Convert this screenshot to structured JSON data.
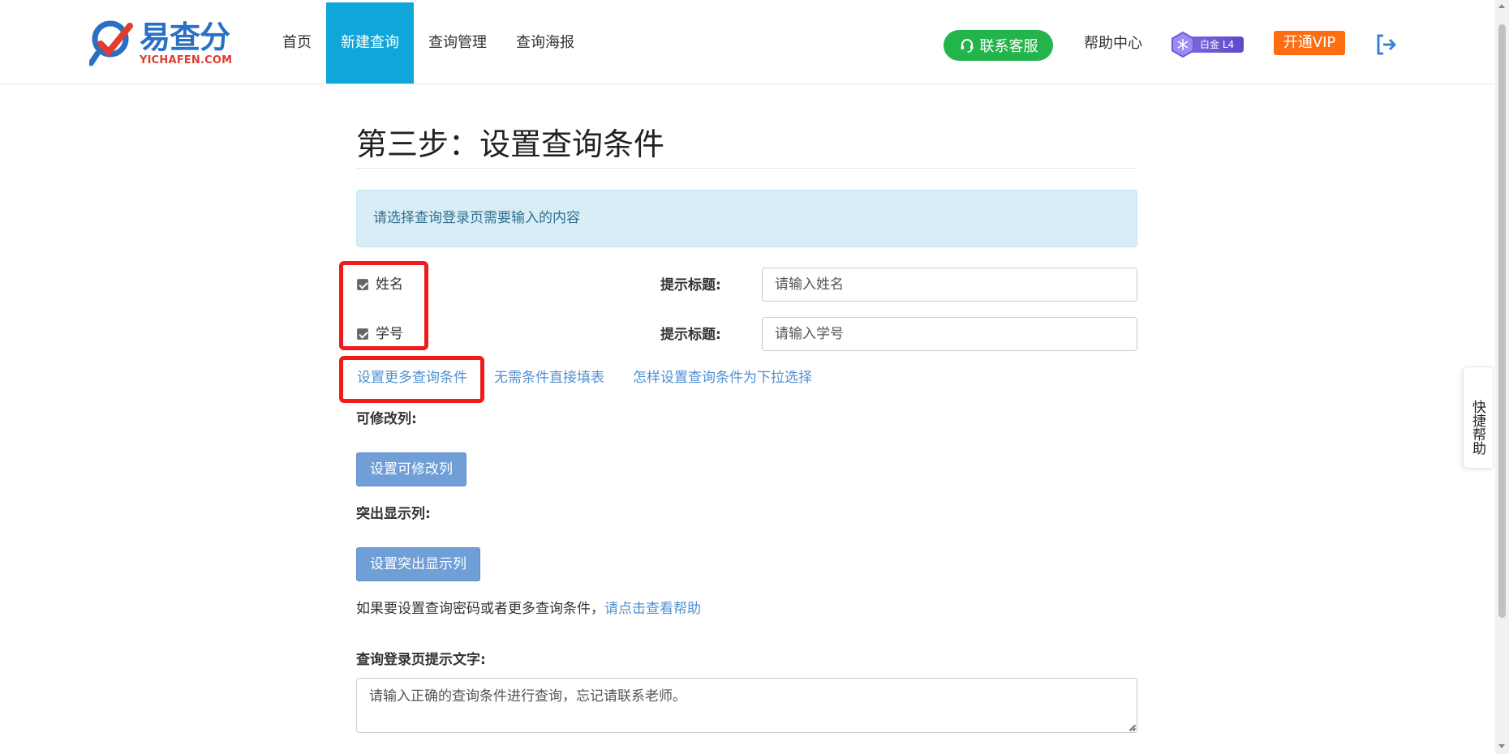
{
  "header": {
    "logo_cn": "易查分",
    "logo_en": "YICHAFEN.COM",
    "nav": [
      "首页",
      "新建查询",
      "查询管理",
      "查询海报"
    ],
    "active_nav_index": 1,
    "service_button": "联系客服",
    "help_center": "帮助中心",
    "level_badge": "白金 L4",
    "vip_button": "开通VIP",
    "colors": {
      "active_nav": "#10a6d9",
      "service": "#23b44b",
      "vip": "#ff6d13"
    }
  },
  "main": {
    "step_title": "第三步：设置查询条件",
    "info_text": "请选择查询登录页需要输入的内容",
    "conditions": [
      {
        "label": "姓名",
        "checked": true,
        "hint_label": "提示标题:",
        "hint_value": "请输入姓名"
      },
      {
        "label": "学号",
        "checked": true,
        "hint_label": "提示标题:",
        "hint_value": "请输入学号"
      }
    ],
    "links": [
      "设置更多查询条件",
      "无需条件直接填表",
      "怎样设置查询条件为下拉选择"
    ],
    "editable_cols_label": "可修改列:",
    "editable_cols_button": "设置可修改列",
    "highlight_cols_label": "突出显示列:",
    "highlight_cols_button": "设置突出显示列",
    "more_note_text": "如果要设置查询密码或者更多查询条件，",
    "more_note_link": "请点击查看帮助",
    "login_tip_label": "查询登录页提示文字:",
    "login_tip_value": "请输入正确的查询条件进行查询，忘记请联系老师。"
  },
  "side": {
    "quick_help": "快捷帮助"
  }
}
